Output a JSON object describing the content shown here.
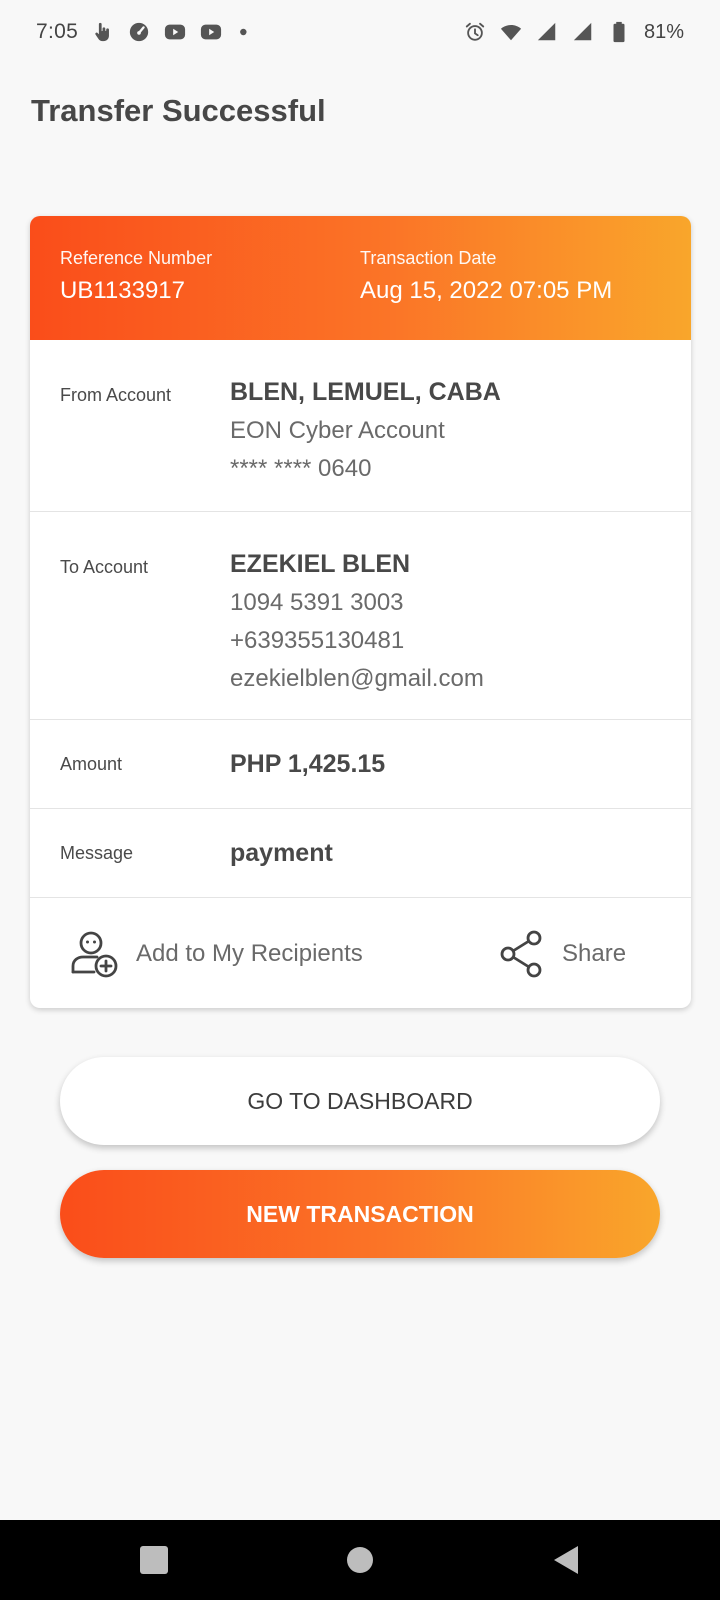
{
  "status_bar": {
    "time": "7:05",
    "battery": "81%",
    "left_icons": [
      "touch-icon",
      "speedometer-icon",
      "youtube-icon",
      "youtube-icon",
      "dot-icon"
    ],
    "right_icons": [
      "alarm-icon",
      "wifi-icon",
      "signal-icon",
      "signal-icon",
      "battery-icon"
    ]
  },
  "page": {
    "title": "Transfer Successful"
  },
  "card": {
    "header": {
      "reference_label": "Reference Number",
      "reference_value": "UB1133917",
      "date_label": "Transaction Date",
      "date_value": "Aug 15, 2022 07:05 PM"
    },
    "from": {
      "label": "From Account",
      "name": "BLEN, LEMUEL, CABA",
      "account_type": "EON Cyber Account",
      "account_number": "**** **** 0640"
    },
    "to": {
      "label": "To Account",
      "name": "EZEKIEL BLEN",
      "account_number": "1094 5391 3003",
      "phone": "+639355130481",
      "email": "ezekielblen@gmail.com"
    },
    "amount": {
      "label": "Amount",
      "value": "PHP 1,425.15"
    },
    "message": {
      "label": "Message",
      "value": "payment"
    },
    "actions": {
      "add_recipient_label": "Add to My Recipients",
      "share_label": "Share"
    }
  },
  "buttons": {
    "dashboard": "GO TO DASHBOARD",
    "new_transaction": "NEW TRANSACTION"
  },
  "colors": {
    "accent_start": "#fa4d1a",
    "accent_mid": "#fb7527",
    "accent_end": "#f9a62b",
    "background": "#f8f8f8",
    "text_dark": "#474747"
  }
}
